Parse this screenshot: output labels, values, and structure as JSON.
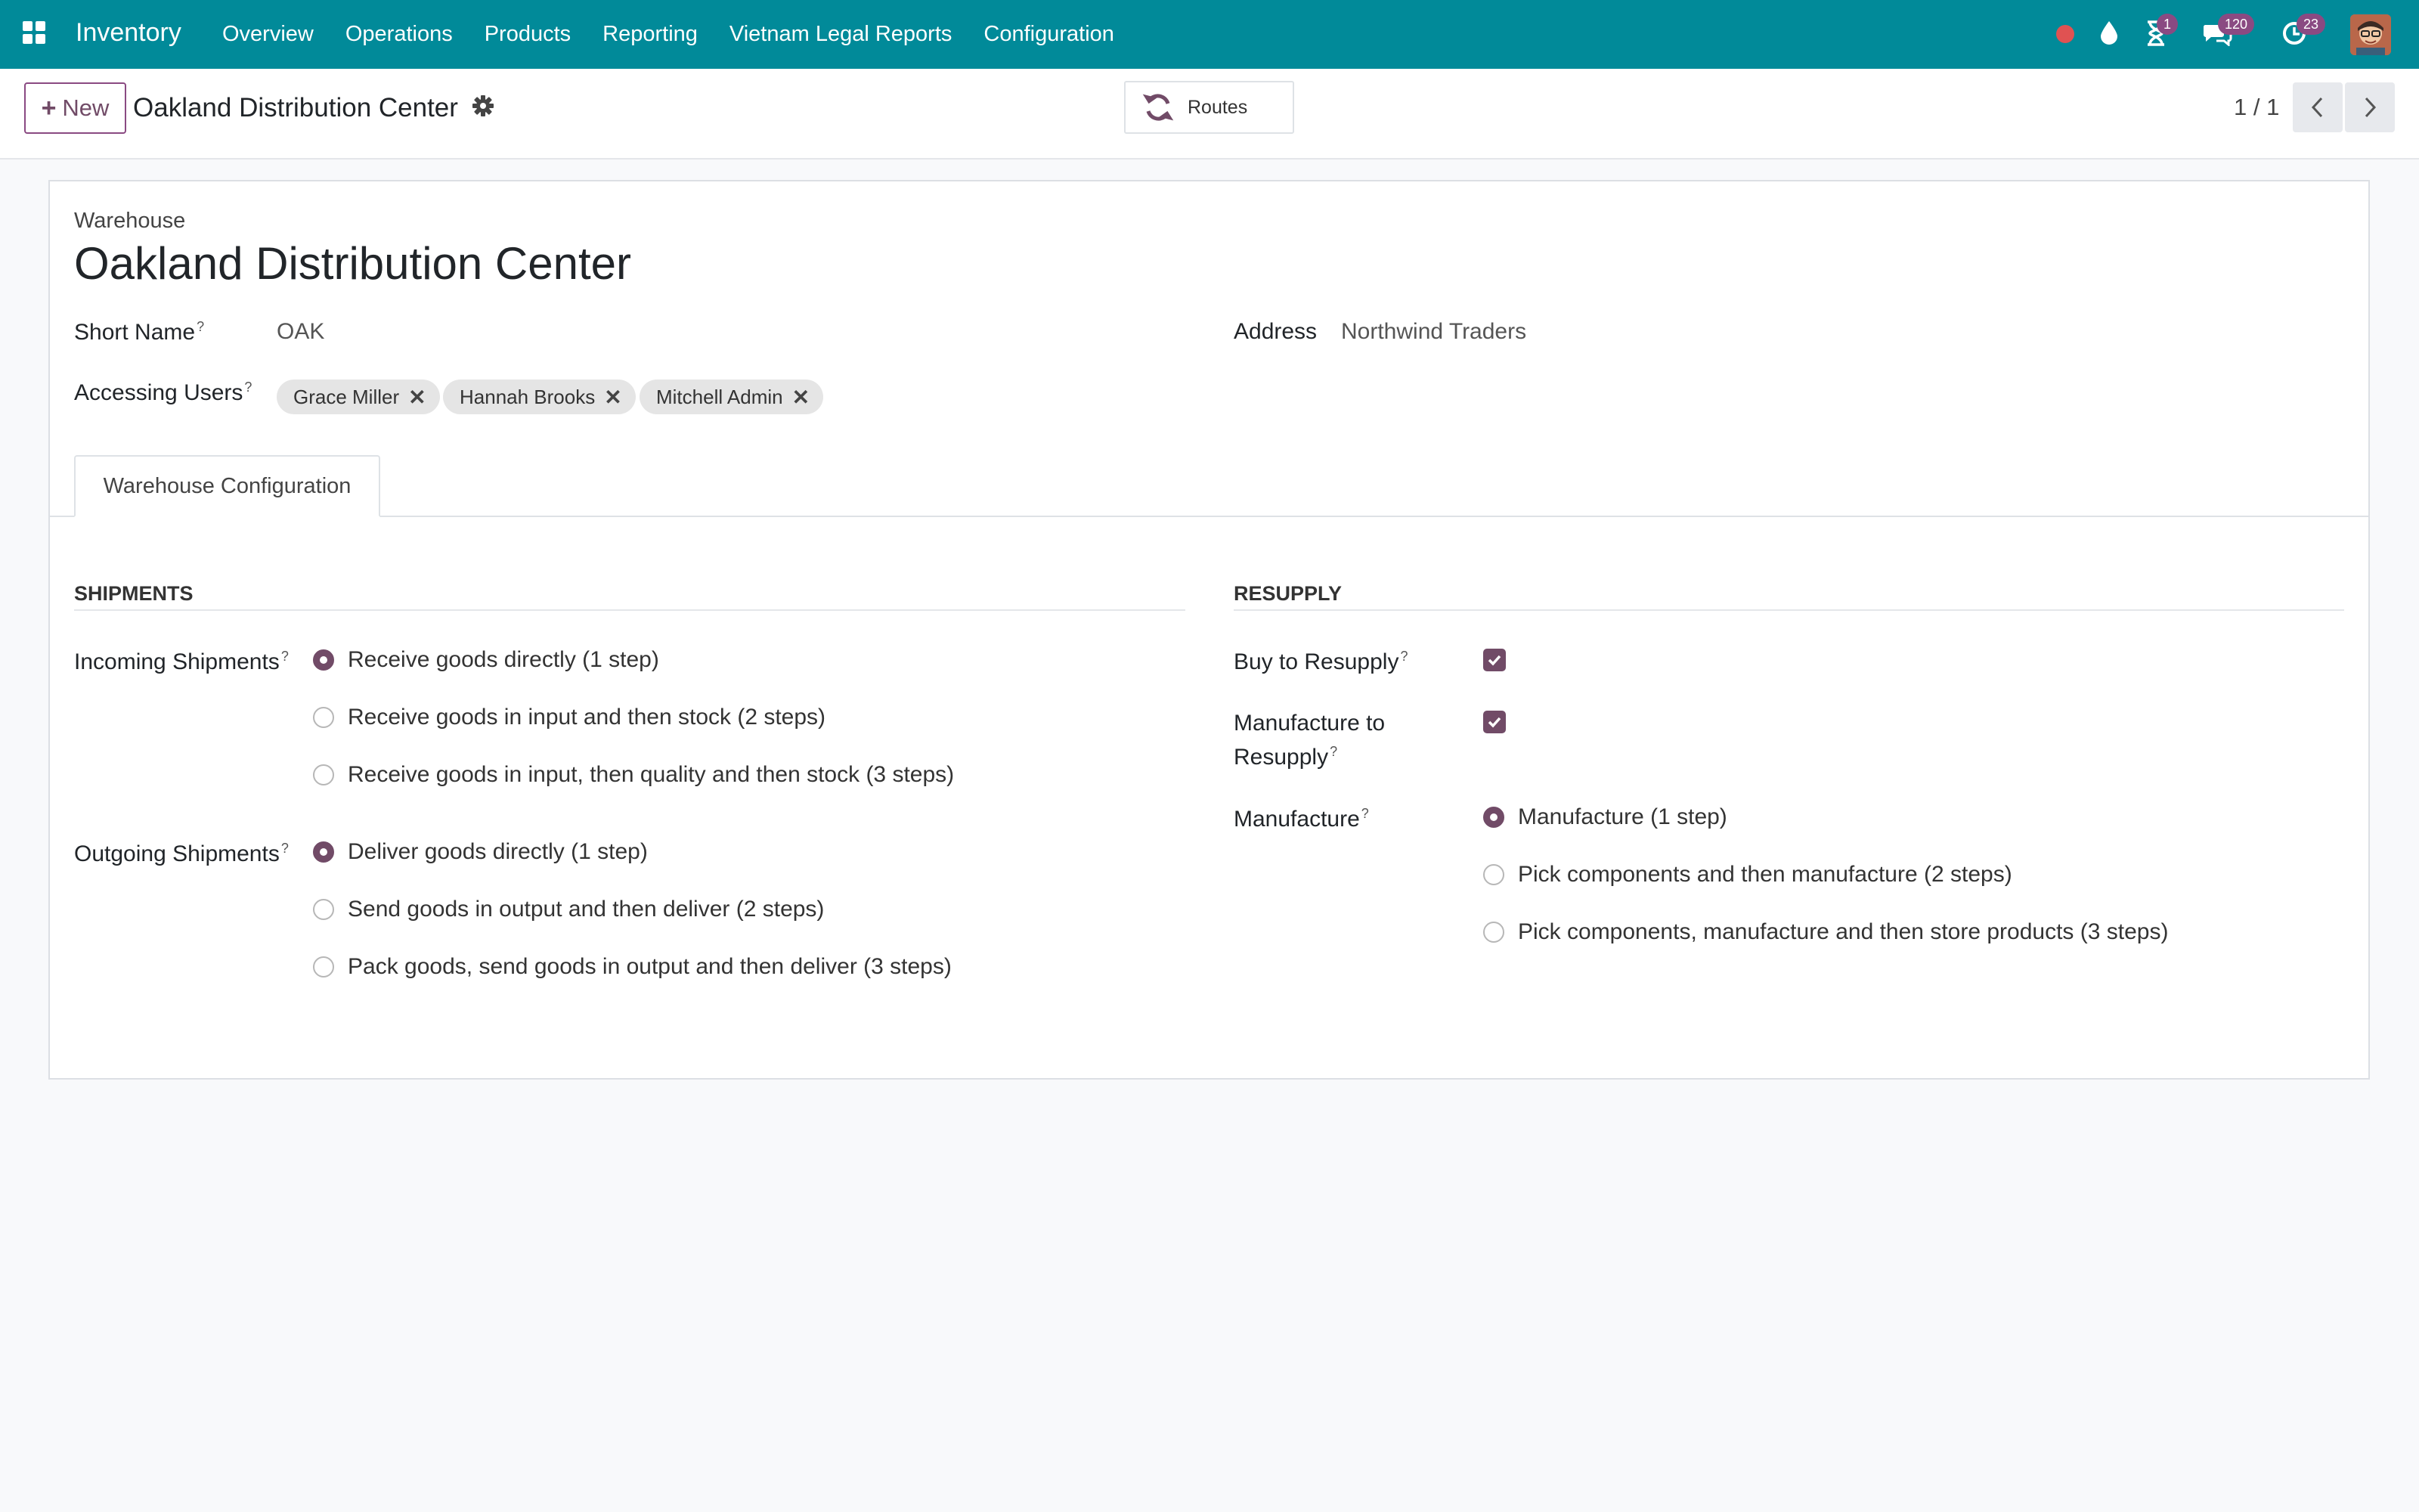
{
  "navbar": {
    "brand": "Inventory",
    "menu": [
      "Overview",
      "Operations",
      "Products",
      "Reporting",
      "Vietnam Legal Reports",
      "Configuration"
    ],
    "badges": {
      "activities": "1",
      "messages": "120",
      "clock": "23"
    },
    "colors": {
      "bar": "#018a99",
      "badge": "#8a4a82",
      "record_dot": "#e05252"
    }
  },
  "control_panel": {
    "new_label": "New",
    "title": "Oakland Distribution Center",
    "routes_label": "Routes",
    "pager": "1 / 1"
  },
  "form": {
    "model_label": "Warehouse",
    "name": "Oakland Distribution Center",
    "short_name_label": "Short Name",
    "short_name": "OAK",
    "address_label": "Address",
    "address": "Northwind Traders",
    "accessing_users_label": "Accessing Users",
    "users": [
      "Grace Miller",
      "Hannah Brooks",
      "Mitchell Admin"
    ],
    "help_mark": "?"
  },
  "tab": {
    "label": "Warehouse Configuration"
  },
  "shipments": {
    "title": "SHIPMENTS",
    "incoming_label": "Incoming Shipments",
    "incoming_options": [
      "Receive goods directly (1 step)",
      "Receive goods in input and then stock (2 steps)",
      "Receive goods in input, then quality and then stock (3 steps)"
    ],
    "incoming_selected": 0,
    "outgoing_label": "Outgoing Shipments",
    "outgoing_options": [
      "Deliver goods directly (1 step)",
      "Send goods in output and then deliver (2 steps)",
      "Pack goods, send goods in output and then deliver (3 steps)"
    ],
    "outgoing_selected": 0
  },
  "resupply": {
    "title": "RESUPPLY",
    "buy_label": "Buy to Resupply",
    "buy_checked": true,
    "manufacture_to_line1": "Manufacture to",
    "manufacture_to_line2": "Resupply",
    "manufacture_to_checked": true,
    "manufacture_label": "Manufacture",
    "manufacture_options": [
      "Manufacture (1 step)",
      "Pick components and then manufacture (2 steps)",
      "Pick components, manufacture and then store products (3 steps)"
    ],
    "manufacture_selected": 0
  },
  "accent": "#714b67"
}
